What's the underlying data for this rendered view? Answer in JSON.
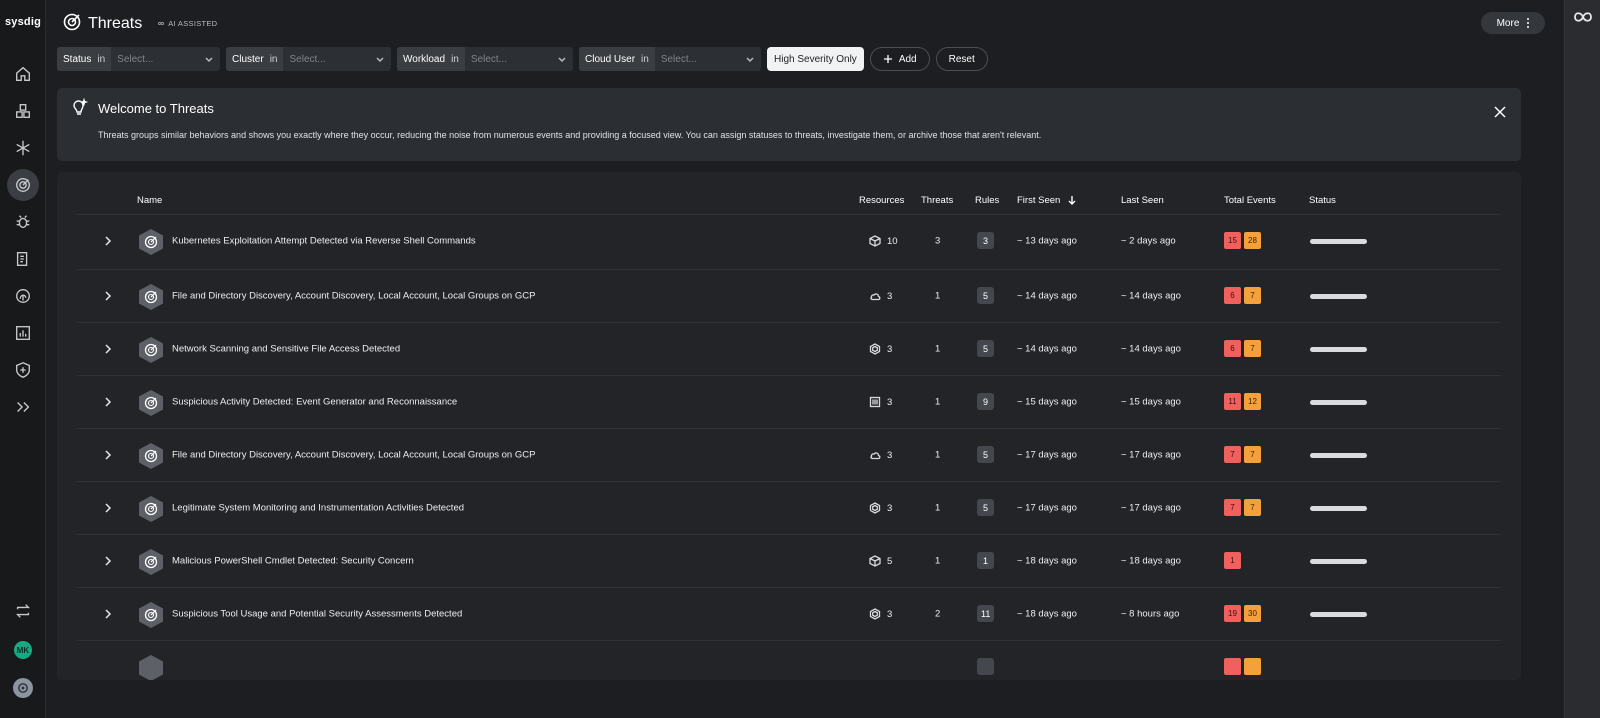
{
  "app": {
    "logo": "sysdig",
    "avatar_initials": "MK"
  },
  "header": {
    "title": "Threats",
    "ai_badge": "AI ASSISTED",
    "more_label": "More"
  },
  "filters": [
    {
      "label": "Status",
      "op": "in",
      "placeholder": "Select..."
    },
    {
      "label": "Cluster",
      "op": "in",
      "placeholder": "Select..."
    },
    {
      "label": "Workload",
      "op": "in",
      "placeholder": "Select..."
    },
    {
      "label": "Cloud User",
      "op": "in",
      "placeholder": "Select..."
    }
  ],
  "filter_buttons": {
    "high_severity": "High Severity Only",
    "add": "Add",
    "reset": "Reset"
  },
  "banner": {
    "title": "Welcome to Threats",
    "text": "Threats groups similar behaviors and shows you exactly where they occur, reducing the noise from numerous events and providing a focused view. You can assign statuses to threats, investigate them, or archive those that aren't relevant."
  },
  "table": {
    "columns": {
      "name": "Name",
      "resources": "Resources",
      "threats": "Threats",
      "rules": "Rules",
      "first_seen": "First Seen",
      "last_seen": "Last Seen",
      "total_events": "Total Events",
      "status": "Status"
    },
    "rows": [
      {
        "name": "Kubernetes Exploitation Attempt Detected via Reverse Shell Commands",
        "resource_icon": "cube-icon",
        "resources": "10",
        "threats": "3",
        "rules": "3",
        "first_seen": "~ 13 days ago",
        "last_seen": "~ 2 days ago",
        "high": "15",
        "medium": "28"
      },
      {
        "name": "File and Directory Discovery, Account Discovery, Local Account, Local Groups on GCP",
        "resource_icon": "cloud-icon",
        "resources": "3",
        "threats": "1",
        "rules": "5",
        "first_seen": "~ 14 days ago",
        "last_seen": "~ 14 days ago",
        "high": "6",
        "medium": "7"
      },
      {
        "name": "Network Scanning and Sensitive File Access Detected",
        "resource_icon": "hexagon-icon",
        "resources": "3",
        "threats": "1",
        "rules": "5",
        "first_seen": "~ 14 days ago",
        "last_seen": "~ 14 days ago",
        "high": "6",
        "medium": "7"
      },
      {
        "name": "Suspicious Activity Detected: Event Generator and Reconnaissance",
        "resource_icon": "server-icon",
        "resources": "3",
        "threats": "1",
        "rules": "9",
        "first_seen": "~ 15 days ago",
        "last_seen": "~ 15 days ago",
        "high": "11",
        "medium": "12"
      },
      {
        "name": "File and Directory Discovery, Account Discovery, Local Account, Local Groups on GCP",
        "resource_icon": "cloud-icon",
        "resources": "3",
        "threats": "1",
        "rules": "5",
        "first_seen": "~ 17 days ago",
        "last_seen": "~ 17 days ago",
        "high": "7",
        "medium": "7"
      },
      {
        "name": "Legitimate System Monitoring and Instrumentation Activities Detected",
        "resource_icon": "hexagon-icon",
        "resources": "3",
        "threats": "1",
        "rules": "5",
        "first_seen": "~ 17 days ago",
        "last_seen": "~ 17 days ago",
        "high": "7",
        "medium": "7"
      },
      {
        "name": "Malicious PowerShell Cmdlet Detected: Security Concern",
        "resource_icon": "cube-icon",
        "resources": "5",
        "threats": "1",
        "rules": "1",
        "first_seen": "~ 18 days ago",
        "last_seen": "~ 18 days ago",
        "high": "1",
        "medium": ""
      },
      {
        "name": "Suspicious Tool Usage and Potential Security Assessments Detected",
        "resource_icon": "hexagon-icon",
        "resources": "3",
        "threats": "2",
        "rules": "11",
        "first_seen": "~ 18 days ago",
        "last_seen": "~ 8 hours ago",
        "high": "19",
        "medium": "30"
      }
    ]
  },
  "colors": {
    "severity_high": "#f0605d",
    "severity_medium": "#f5a13b",
    "background": "#1c1e21",
    "panel": "#2b2e32",
    "avatar": "#19a982"
  }
}
